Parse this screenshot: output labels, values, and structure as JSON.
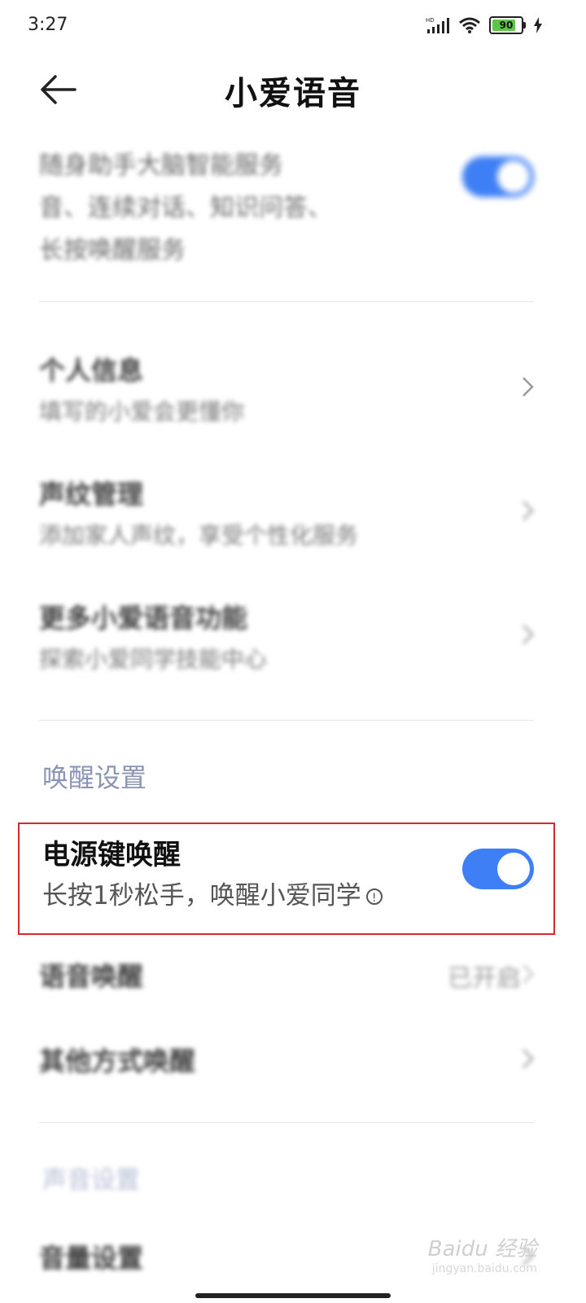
{
  "status_bar": {
    "time": "3:27",
    "network_label": "HD",
    "battery_level": "90",
    "battery_color": "#5ec44a"
  },
  "header": {
    "title": "小爱语音",
    "back_icon": "arrow-left-icon"
  },
  "main": {
    "top_item": {
      "desc_line1": "随身助手大脑智能服务",
      "desc_line2": "音、连续对话、知识问答、",
      "desc_line3": "长按唤醒服务",
      "toggle_on": true
    },
    "items": [
      {
        "title": "个人信息",
        "subtitle": "填写的小爱会更懂你"
      },
      {
        "title": "声纹管理",
        "subtitle": "添加家人声纹，享受个性化服务"
      },
      {
        "title": "更多小爱语音功能",
        "subtitle": "探索小爱同学技能中心"
      }
    ],
    "wake_section": {
      "label": "唤醒设置",
      "power_key": {
        "title": "电源键唤醒",
        "subtitle": "长按1秒松手，唤醒小爱同学",
        "toggle_on": true
      },
      "voice_wake": {
        "title": "语音唤醒",
        "value": "已开启"
      },
      "other_wake": {
        "title": "其他方式唤醒"
      }
    },
    "sound_section": {
      "label": "声音设置",
      "first_item": {
        "title": "音量设置"
      }
    }
  },
  "watermark": {
    "brand": "Baidu 经验",
    "site": "jingyan.baidu.com"
  },
  "colors": {
    "accent": "#3e7ff5",
    "highlight": "#d8282a",
    "section_label": "#8a94b5"
  }
}
